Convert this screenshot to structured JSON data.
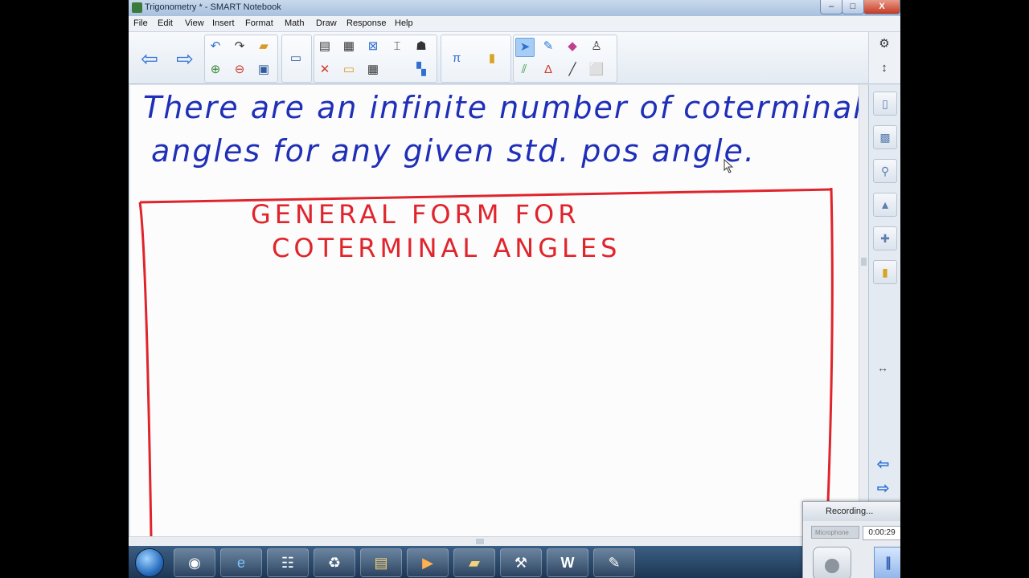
{
  "window": {
    "title": "Trigonometry * - SMART Notebook",
    "controls": [
      "–",
      "□",
      "X"
    ]
  },
  "menu": [
    "File",
    "Edit",
    "View",
    "Insert",
    "Format",
    "Math",
    "Draw",
    "Response",
    "Help"
  ],
  "toolbar": {
    "icons": [
      "back-arrow",
      "forward-arrow",
      "undo",
      "redo",
      "open-folder",
      "screen-shade",
      "delete",
      "table",
      "capture",
      "math",
      "response",
      "select",
      "pen",
      "eraser",
      "line",
      "shape",
      "text"
    ]
  },
  "canvas": {
    "line1": "There are an infinite number of coterminal",
    "line2": "angles for any given std. pos angle.",
    "box_title_1": "GENERAL FORM FOR",
    "box_title_2": "COTERMINAL ANGLES",
    "colors": {
      "blue_ink": "#1f2fb8",
      "red_ink": "#e0242c"
    }
  },
  "recorder": {
    "title": "Recording...",
    "dropdown": "Microphone",
    "time": "0:00:29"
  }
}
